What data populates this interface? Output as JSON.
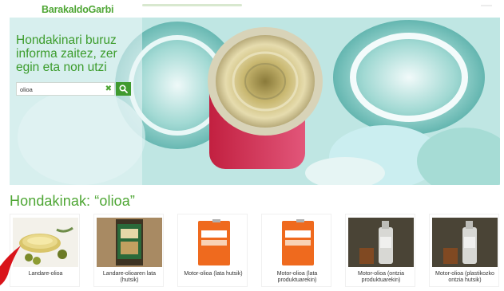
{
  "header": {
    "logo_text": "BarakaldoGarbi"
  },
  "hero": {
    "title": "Hondakinari buruz informa zaitez, zer egin eta non utzi",
    "search": {
      "value": "olioa",
      "clear_icon": "close-icon",
      "button_icon": "search-icon"
    }
  },
  "results": {
    "heading": "Hondakinak: “olioa”",
    "items": [
      {
        "label": "Landare-olioa",
        "thumb": "olive-oil-bowl"
      },
      {
        "label": "Landare-olioaren lata (hutsik)",
        "thumb": "oil-tin"
      },
      {
        "label": "Motor-olioa (lata hutsik)",
        "thumb": "motor-oil-can"
      },
      {
        "label": "Motor-olioa (lata produktuarekin)",
        "thumb": "motor-oil-can"
      },
      {
        "label": "Motor-olioa (ontzia produktuarekin)",
        "thumb": "motor-oil-bottle"
      },
      {
        "label": "Motor-olioa (plastikozko ontzia hutsik)",
        "thumb": "motor-oil-bottle"
      }
    ]
  },
  "colors": {
    "brand_green": "#4ea634",
    "button_green": "#3f9a2f"
  }
}
